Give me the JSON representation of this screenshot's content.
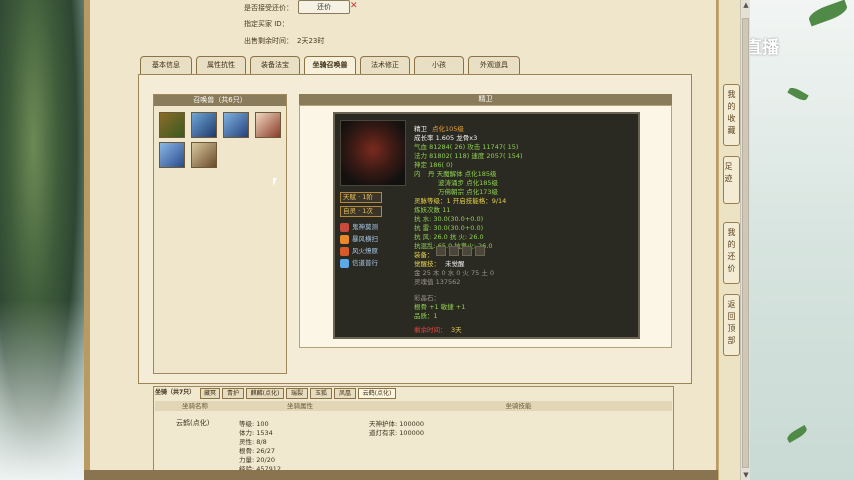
{
  "watermark": "CC直播",
  "top": {
    "accept_return_label": "是否接受还价：",
    "return_button": "还价",
    "seller_id_label": "指定买家 ID：",
    "time_left_label": "出售剩余时间：",
    "time_left_value": "2天23时"
  },
  "tabs": [
    "基本信息",
    "属性抗性",
    "装备法宝",
    "坐骑召唤兽",
    "法术修正",
    "小孩",
    "外观道具"
  ],
  "active_tab": "坐骑召唤兽",
  "summon": {
    "list_header": "召唤兽（共6只）",
    "detail_header": "精卫",
    "name": "精卫",
    "rank": "点化105级",
    "growth": "成长率 1.605 龙骨x3",
    "hp": "气血 81284( 26) 攻击 11747( 15)",
    "mp": "法力 81802( 118) 速度 2057( 154)",
    "loyalty": "神定 186( 0)",
    "inner1_label": "内",
    "inner1": "丹 天魔解体 点化185级",
    "inner2": "波涛涌步 点化185级",
    "inner3": "万佛朝宗 点化173级",
    "spirit": "灵脉等级：1 开启技能格：9/14",
    "train_count": "炼妖次数 11",
    "resist_water": "抗   水: 30.0(30.0+0.0)",
    "resist_thunder": "抗   雷: 30.0(30.0+0.0)",
    "resist_wind_fire": "抗   风: 26.0 抗   火: 26.0",
    "resist_misc": "抗混乱: 65.0 抗鬼火: 26.0",
    "equip_label": "装备：",
    "awaken_label": "觉醒技：",
    "awaken_value": "未觉醒",
    "elements": "金 25 木 0 水 0 火 75 土 0",
    "exp": "灵魂值 137562",
    "color_stone": "彩晶石：",
    "stone1": "根骨 +1 敏捷 +1",
    "stone2": "品质：1",
    "remain_label": "剩余时间：",
    "remain_value": "3天",
    "skill_badges": [
      "天赋 · 1阶",
      "自灵 · 1次"
    ],
    "skills": [
      "鬼神莫测",
      "暴风横扫",
      "风火燎原",
      "信道普行"
    ]
  },
  "mount": {
    "title": "坐骑（共7只）",
    "tabs": [
      "藏冥",
      "青护",
      "麒麟(点化)",
      "瑞裂",
      "玉狐",
      "凤凰",
      "云鹤(点化)"
    ],
    "active_tab": "云鹤(点化)",
    "col_name": "坐骑名称",
    "col_attr": "坐骑属性",
    "col_skill": "坐骑技能",
    "name": "云鹤(点化)",
    "attrs": [
      "等级: 100",
      "体力: 1534",
      "灵性: 8/8",
      "根骨: 26/27",
      "力量: 20/20",
      "经验: 457912"
    ],
    "skills": [
      "天神护体: 100000",
      "道灯有求: 100000"
    ]
  },
  "sidebar": [
    "我的收藏",
    "足迹",
    "我的还价",
    "返回顶部"
  ]
}
